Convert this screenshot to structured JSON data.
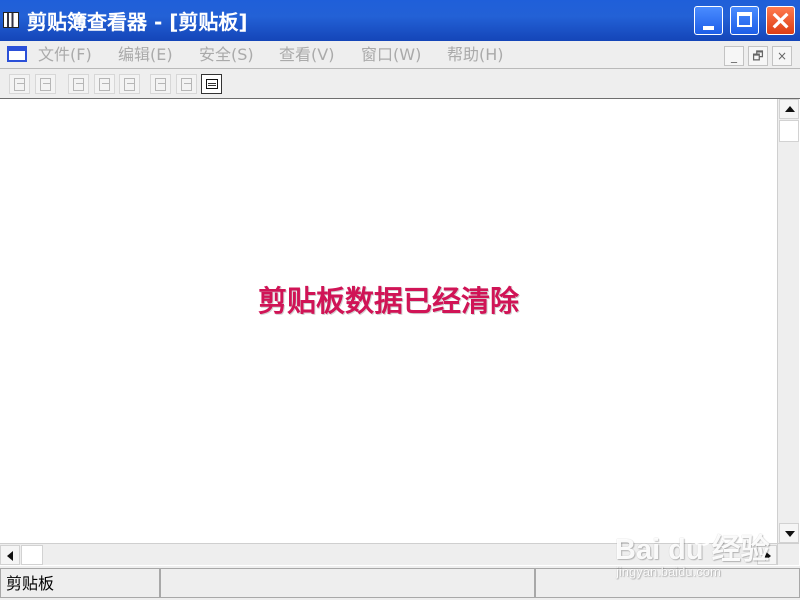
{
  "window": {
    "title": "剪贴簿查看器 - [剪贴板]",
    "title_icon": "clipboard-viewer-icon",
    "controls": {
      "minimize_icon": "minimize-icon",
      "maximize_icon": "maximize-icon",
      "close_icon": "close-icon"
    }
  },
  "menu": {
    "document_icon": "document-window-icon",
    "items": [
      {
        "label": "文件(F)"
      },
      {
        "label": "编辑(E)"
      },
      {
        "label": "安全(S)"
      },
      {
        "label": "查看(V)"
      },
      {
        "label": "窗口(W)"
      },
      {
        "label": "帮助(H)"
      }
    ],
    "child_controls": {
      "minimize": "_",
      "restore": "🗗",
      "close": "×"
    }
  },
  "toolbar": {
    "buttons": [
      {
        "icon": "open-icon"
      },
      {
        "icon": "save-icon"
      },
      {
        "icon": "copy-icon"
      },
      {
        "icon": "paste-icon"
      },
      {
        "icon": "delete-icon"
      },
      {
        "icon": "table-view-icon"
      },
      {
        "icon": "list-view-icon"
      },
      {
        "icon": "clipboard-view-icon",
        "active": true
      }
    ]
  },
  "content": {
    "message": "剪贴板数据已经清除",
    "message_color": "#d01456"
  },
  "status": {
    "left": "剪贴板",
    "middle": "",
    "right": ""
  },
  "watermark": {
    "main": "Bai du 经验",
    "sub": "jingyan.baidu.com",
    "icon": "paw-icon"
  },
  "colors": {
    "titlebar": "#1f5fd9",
    "menubar": "#eeeeee",
    "disabled_text": "#aaaaaa",
    "close_button": "#dc3d14"
  }
}
